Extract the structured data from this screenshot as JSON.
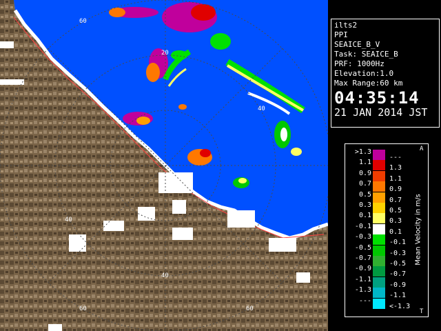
{
  "info": {
    "site": "ilts2",
    "product": "PPI",
    "field": "SEAICE_B_V",
    "task": "Task: SEAICE_B",
    "prf": "PRF: 1000Hz",
    "elevation": "Elevation:1.0",
    "max_range": "Max Range:60 km",
    "time": "04:35:14",
    "date": "21 JAN 2014 JST"
  },
  "legend": {
    "title": "Mean Velocity in m/s",
    "corner_top": "A",
    "corner_bottom": "T",
    "entries": [
      {
        "low": ">1.3",
        "high": "---",
        "color": "#c0009c"
      },
      {
        "low": "1.1",
        "high": "1.3",
        "color": "#e00000"
      },
      {
        "low": "0.9",
        "high": "1.1",
        "color": "#f03c00"
      },
      {
        "low": "0.7",
        "high": "0.9",
        "color": "#ff7800"
      },
      {
        "low": "0.5",
        "high": "0.7",
        "color": "#ffa000"
      },
      {
        "low": "0.3",
        "high": "0.5",
        "color": "#ffd200"
      },
      {
        "low": "0.1",
        "high": "0.3",
        "color": "#ffff64"
      },
      {
        "low": "-0.1",
        "high": "0.1",
        "color": "#ffffff"
      },
      {
        "low": "-0.3",
        "high": "-0.1",
        "color": "#00e000"
      },
      {
        "low": "-0.5",
        "high": "-0.3",
        "color": "#00c800"
      },
      {
        "low": "-0.7",
        "high": "-0.5",
        "color": "#30b030"
      },
      {
        "low": "-0.9",
        "high": "-0.7",
        "color": "#009a40"
      },
      {
        "low": "-1.1",
        "high": "-0.9",
        "color": "#00a080"
      },
      {
        "low": "-1.3",
        "high": "-1.1",
        "color": "#00b8c8"
      },
      {
        "low": "---",
        "high": "<-1.3",
        "color": "#00e8ff"
      }
    ]
  },
  "range_labels": [
    "20",
    "40",
    "60"
  ],
  "colors": {
    "sea": "#0050ff",
    "land": "#7a6448",
    "land_dark": "#4c3c2a",
    "coast": "#ffffff"
  }
}
